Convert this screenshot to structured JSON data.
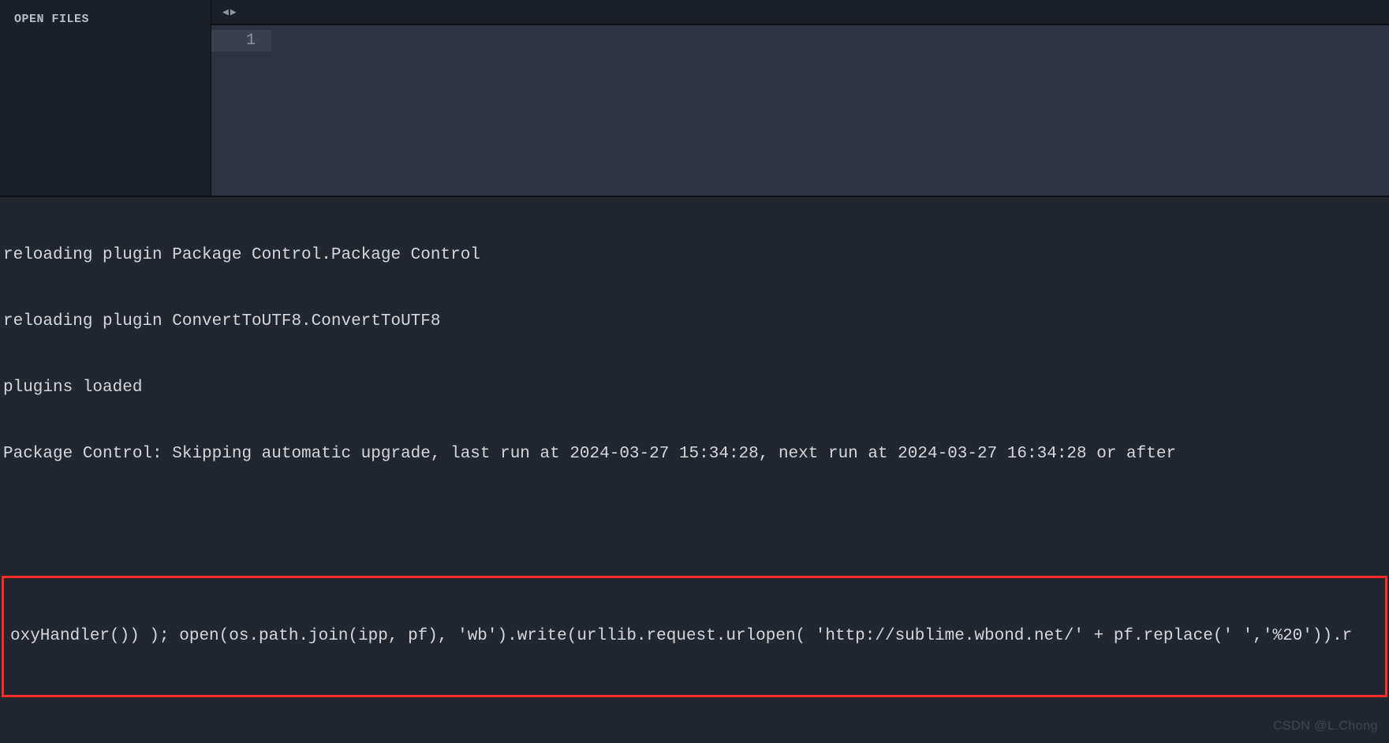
{
  "sidebar": {
    "title": "OPEN FILES"
  },
  "editor": {
    "line_numbers": [
      "1"
    ]
  },
  "tabbar": {
    "prev": "◀",
    "next": "▶"
  },
  "console": {
    "lines": [
      "reloading plugin Package Control.Package Control",
      "reloading plugin ConvertToUTF8.ConvertToUTF8",
      "plugins loaded",
      "Package Control: Skipping automatic upgrade, last run at 2024-03-27 15:34:28, next run at 2024-03-27 16:34:28 or after"
    ],
    "input": "oxyHandler()) ); open(os.path.join(ipp, pf), 'wb').write(urllib.request.urlopen( 'http://sublime.wbond.net/' + pf.replace(' ','%20')).r"
  },
  "watermark": "CSDN @L.Chong"
}
